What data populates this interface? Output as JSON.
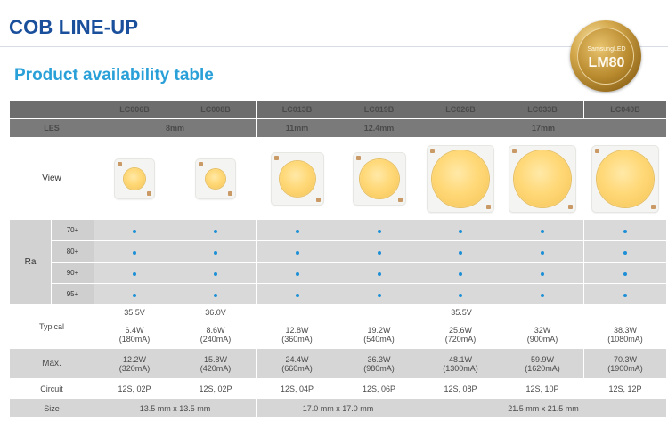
{
  "page": {
    "title": "COB LINE-UP",
    "subtitle": "Product availability table",
    "seal_brand": "SamsungLED",
    "seal_model": "LM80"
  },
  "table": {
    "models": [
      "LC006B",
      "LC008B",
      "LC013B",
      "LC019B",
      "LC026B",
      "LC033B",
      "LC040B"
    ],
    "les_label": "LES",
    "les_values": [
      "8mm",
      "11mm",
      "12.4mm",
      "17mm"
    ],
    "view_label": "View",
    "ra_label": "Ra",
    "ra_levels": [
      "70+",
      "80+",
      "90+",
      "95+"
    ],
    "typical_label": "Typical",
    "typical_voltage": [
      "35.5V",
      "36.0V",
      "35.5V"
    ],
    "typical_power": [
      "6.4W",
      "8.6W",
      "12.8W",
      "19.2W",
      "25.6W",
      "32W",
      "38.3W"
    ],
    "typical_current": [
      "(180mA)",
      "(240mA)",
      "(360mA)",
      "(540mA)",
      "(720mA)",
      "(900mA)",
      "(1080mA)"
    ],
    "max_label": "Max.",
    "max_power": [
      "12.2W",
      "15.8W",
      "24.4W",
      "36.3W",
      "48.1W",
      "59.9W",
      "70.3W"
    ],
    "max_current": [
      "(320mA)",
      "(420mA)",
      "(660mA)",
      "(980mA)",
      "(1300mA)",
      "(1620mA)",
      "(1900mA)"
    ],
    "circuit_label": "Circuit",
    "circuit": [
      "12S, 02P",
      "12S, 02P",
      "12S, 04P",
      "12S, 06P",
      "12S, 08P",
      "12S, 10P",
      "12S, 12P"
    ],
    "size_label": "Size",
    "size_values": [
      "13.5 mm x 13.5 mm",
      "17.0 mm x 17.0 mm",
      "21.5 mm x 21.5 mm"
    ]
  },
  "colors": {
    "title": "#1a4f9c",
    "subtitle": "#2aa0d8",
    "header": "#6d6d6d",
    "dot": "#1c8fd6",
    "led": "#ffd877"
  }
}
